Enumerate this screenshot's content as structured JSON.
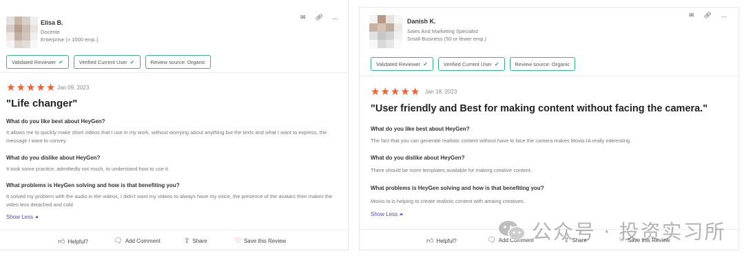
{
  "reviews": [
    {
      "reviewer": {
        "name": "Elisa B.",
        "role": "Docente",
        "company_size": "Enterprise (> 1000 emp.)"
      },
      "actions": {
        "email_icon": "envelope-icon",
        "link_icon": "link-icon",
        "more": "..."
      },
      "badges": [
        "Validated Reviewer",
        "Verified Current User",
        "Review source: Organic"
      ],
      "rating": 5,
      "date": "Jan 09, 2023",
      "title": "\"Life changer\"",
      "qa": [
        {
          "q": "What do you like best about HeyGen?",
          "a": "It allows me to quickly make short videos that I use in my work, without worrying about anything but the texts and what I want to express, the message I want to convey."
        },
        {
          "q": "What do you dislike about HeyGen?",
          "a": "It took some practice, admittedly not much, to understand how to use it."
        },
        {
          "q": "What problems is HeyGen solving and how is that benefiting you?",
          "a": "It solved my problem with the audio in the videos, I didn't want my videos to always have my voice, the presence of the avatars then makes the video less detached and cold"
        }
      ],
      "show_less": "Show Less",
      "footer": {
        "helpful": "Helpful?",
        "comment": "Add Comment",
        "share": "Share",
        "save": "Save this Review"
      }
    },
    {
      "reviewer": {
        "name": "Danish K.",
        "role": "Sales And Marketing Specialist",
        "company_size": "Small-Business (50 or fewer emp.)"
      },
      "actions": {
        "email_icon": "envelope-icon",
        "link_icon": "link-icon",
        "more": "..."
      },
      "badges": [
        "Validated Reviewer",
        "Verified Current User",
        "Review source: Organic"
      ],
      "rating": 5,
      "date": "Jan 18, 2023",
      "title": "\"User friendly and Best for making content without facing the camera.\"",
      "qa": [
        {
          "q": "What do you like best about HeyGen?",
          "a": "The fact that you can generate realistic content without have to face the camera makes Movio.IA really interesting."
        },
        {
          "q": "What do you dislike about HeyGen?",
          "a": "There should be more templates available for making creative content."
        },
        {
          "q": "What problems is HeyGen solving and how is that benefiting you?",
          "a": "Movio.Ia is helping to create realistic content with amaing creatives."
        }
      ],
      "show_less": "Show Less",
      "footer": {
        "helpful": "Helpful?",
        "comment": "Add Comment",
        "share": "Share",
        "save": "Save this Review"
      }
    }
  ],
  "watermark": {
    "text": "公众号 · 投资实习所"
  },
  "colors": {
    "star": "#ff5a2c",
    "badge_border": "#36b38f",
    "link": "#5b3fb8"
  }
}
